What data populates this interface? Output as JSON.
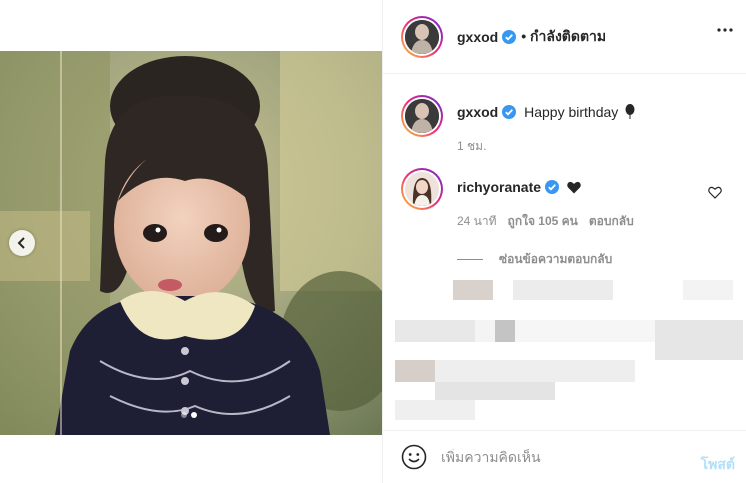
{
  "post": {
    "author": "gxxod",
    "follow_status": "• กำลังติดตาม",
    "caption": "Happy birthday",
    "caption_time": "1 ชม.",
    "photo_alt": ""
  },
  "comment": {
    "user": "richyoranate",
    "time": "24 นาที",
    "likes": "ถูกใจ 105 คน",
    "reply": "ตอบกลับ",
    "hide_replies": "ซ่อนข้อความตอบกลับ"
  },
  "composer": {
    "placeholder": "เพิ่มความคิดเห็น",
    "post_label": "โพสต์"
  },
  "carousel": {
    "current": 2,
    "total": 2
  },
  "colors": {
    "verified": "#3897f0",
    "muted": "#8e8e8e",
    "post_disabled": "#b2dffc"
  },
  "icons": [
    "more-icon",
    "verified-icon",
    "balloon-icon",
    "black-heart-icon",
    "heart-outline-icon",
    "emoji-icon",
    "chevron-left-icon"
  ]
}
